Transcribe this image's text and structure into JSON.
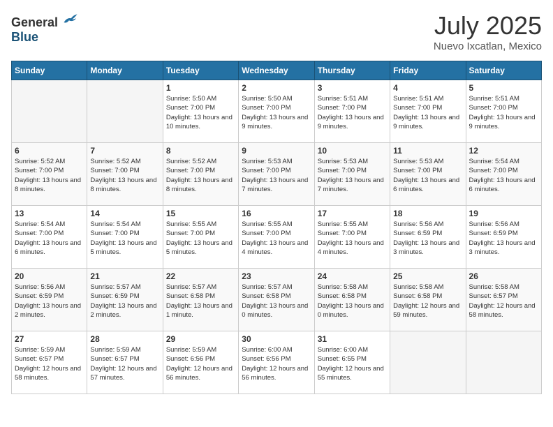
{
  "header": {
    "logo_general": "General",
    "logo_blue": "Blue",
    "month": "July 2025",
    "location": "Nuevo Ixcatlan, Mexico"
  },
  "days_of_week": [
    "Sunday",
    "Monday",
    "Tuesday",
    "Wednesday",
    "Thursday",
    "Friday",
    "Saturday"
  ],
  "weeks": [
    [
      {
        "day": "",
        "info": ""
      },
      {
        "day": "",
        "info": ""
      },
      {
        "day": "1",
        "info": "Sunrise: 5:50 AM\nSunset: 7:00 PM\nDaylight: 13 hours\nand 10 minutes."
      },
      {
        "day": "2",
        "info": "Sunrise: 5:50 AM\nSunset: 7:00 PM\nDaylight: 13 hours\nand 9 minutes."
      },
      {
        "day": "3",
        "info": "Sunrise: 5:51 AM\nSunset: 7:00 PM\nDaylight: 13 hours\nand 9 minutes."
      },
      {
        "day": "4",
        "info": "Sunrise: 5:51 AM\nSunset: 7:00 PM\nDaylight: 13 hours\nand 9 minutes."
      },
      {
        "day": "5",
        "info": "Sunrise: 5:51 AM\nSunset: 7:00 PM\nDaylight: 13 hours\nand 9 minutes."
      }
    ],
    [
      {
        "day": "6",
        "info": "Sunrise: 5:52 AM\nSunset: 7:00 PM\nDaylight: 13 hours\nand 8 minutes."
      },
      {
        "day": "7",
        "info": "Sunrise: 5:52 AM\nSunset: 7:00 PM\nDaylight: 13 hours\nand 8 minutes."
      },
      {
        "day": "8",
        "info": "Sunrise: 5:52 AM\nSunset: 7:00 PM\nDaylight: 13 hours\nand 8 minutes."
      },
      {
        "day": "9",
        "info": "Sunrise: 5:53 AM\nSunset: 7:00 PM\nDaylight: 13 hours\nand 7 minutes."
      },
      {
        "day": "10",
        "info": "Sunrise: 5:53 AM\nSunset: 7:00 PM\nDaylight: 13 hours\nand 7 minutes."
      },
      {
        "day": "11",
        "info": "Sunrise: 5:53 AM\nSunset: 7:00 PM\nDaylight: 13 hours\nand 6 minutes."
      },
      {
        "day": "12",
        "info": "Sunrise: 5:54 AM\nSunset: 7:00 PM\nDaylight: 13 hours\nand 6 minutes."
      }
    ],
    [
      {
        "day": "13",
        "info": "Sunrise: 5:54 AM\nSunset: 7:00 PM\nDaylight: 13 hours\nand 6 minutes."
      },
      {
        "day": "14",
        "info": "Sunrise: 5:54 AM\nSunset: 7:00 PM\nDaylight: 13 hours\nand 5 minutes."
      },
      {
        "day": "15",
        "info": "Sunrise: 5:55 AM\nSunset: 7:00 PM\nDaylight: 13 hours\nand 5 minutes."
      },
      {
        "day": "16",
        "info": "Sunrise: 5:55 AM\nSunset: 7:00 PM\nDaylight: 13 hours\nand 4 minutes."
      },
      {
        "day": "17",
        "info": "Sunrise: 5:55 AM\nSunset: 7:00 PM\nDaylight: 13 hours\nand 4 minutes."
      },
      {
        "day": "18",
        "info": "Sunrise: 5:56 AM\nSunset: 6:59 PM\nDaylight: 13 hours\nand 3 minutes."
      },
      {
        "day": "19",
        "info": "Sunrise: 5:56 AM\nSunset: 6:59 PM\nDaylight: 13 hours\nand 3 minutes."
      }
    ],
    [
      {
        "day": "20",
        "info": "Sunrise: 5:56 AM\nSunset: 6:59 PM\nDaylight: 13 hours\nand 2 minutes."
      },
      {
        "day": "21",
        "info": "Sunrise: 5:57 AM\nSunset: 6:59 PM\nDaylight: 13 hours\nand 2 minutes."
      },
      {
        "day": "22",
        "info": "Sunrise: 5:57 AM\nSunset: 6:58 PM\nDaylight: 13 hours\nand 1 minute."
      },
      {
        "day": "23",
        "info": "Sunrise: 5:57 AM\nSunset: 6:58 PM\nDaylight: 13 hours\nand 0 minutes."
      },
      {
        "day": "24",
        "info": "Sunrise: 5:58 AM\nSunset: 6:58 PM\nDaylight: 13 hours\nand 0 minutes."
      },
      {
        "day": "25",
        "info": "Sunrise: 5:58 AM\nSunset: 6:58 PM\nDaylight: 12 hours\nand 59 minutes."
      },
      {
        "day": "26",
        "info": "Sunrise: 5:58 AM\nSunset: 6:57 PM\nDaylight: 12 hours\nand 58 minutes."
      }
    ],
    [
      {
        "day": "27",
        "info": "Sunrise: 5:59 AM\nSunset: 6:57 PM\nDaylight: 12 hours\nand 58 minutes."
      },
      {
        "day": "28",
        "info": "Sunrise: 5:59 AM\nSunset: 6:57 PM\nDaylight: 12 hours\nand 57 minutes."
      },
      {
        "day": "29",
        "info": "Sunrise: 5:59 AM\nSunset: 6:56 PM\nDaylight: 12 hours\nand 56 minutes."
      },
      {
        "day": "30",
        "info": "Sunrise: 6:00 AM\nSunset: 6:56 PM\nDaylight: 12 hours\nand 56 minutes."
      },
      {
        "day": "31",
        "info": "Sunrise: 6:00 AM\nSunset: 6:55 PM\nDaylight: 12 hours\nand 55 minutes."
      },
      {
        "day": "",
        "info": ""
      },
      {
        "day": "",
        "info": ""
      }
    ]
  ]
}
